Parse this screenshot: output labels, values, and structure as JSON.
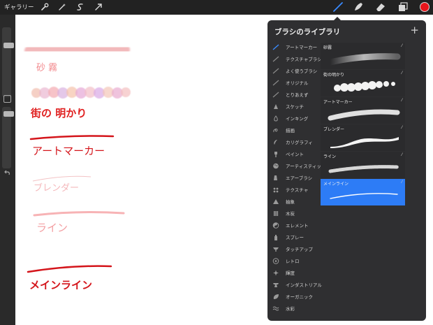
{
  "topbar": {
    "gallery_label": "ギャラリー",
    "tools_left": [
      "wrench-icon",
      "magic-wand-icon",
      "selection-icon",
      "transform-arrow-icon"
    ],
    "tools_right": [
      "brush-icon",
      "smudge-icon",
      "eraser-icon",
      "layers-icon"
    ],
    "active_tool": "brush",
    "current_color": "#e8151b"
  },
  "canvas": {
    "labels": {
      "sunago": "砂 霧",
      "machi": "街の 明かり",
      "art": "アートマーカー",
      "blender": "ブレンダー",
      "line": "ライン",
      "main": "メインライン"
    }
  },
  "panel": {
    "title": "ブラシのライブラリ",
    "add_label": "+",
    "categories": [
      {
        "label": "アートマーカー",
        "icon": "marker-icon"
      },
      {
        "label": "テクスチャブラシ",
        "icon": "stroke-icon"
      },
      {
        "label": "よく使うブラシ",
        "icon": "stroke-icon"
      },
      {
        "label": "オリジナル",
        "icon": "stroke-icon"
      },
      {
        "label": "とりあえず",
        "icon": "stroke-icon"
      },
      {
        "label": "スケッチ",
        "icon": "pencil-icon"
      },
      {
        "label": "インキング",
        "icon": "ink-drop-icon"
      },
      {
        "label": "描画",
        "icon": "loop-icon"
      },
      {
        "label": "カリグラフィ",
        "icon": "calligraphy-icon"
      },
      {
        "label": "ペイント",
        "icon": "paint-brush-icon"
      },
      {
        "label": "アーティスティック",
        "icon": "palette-icon"
      },
      {
        "label": "エアーブラシ",
        "icon": "airbrush-icon"
      },
      {
        "label": "テクスチャ",
        "icon": "texture-icon"
      },
      {
        "label": "抽象",
        "icon": "triangle-icon"
      },
      {
        "label": "木炭",
        "icon": "charcoal-icon"
      },
      {
        "label": "エレメント",
        "icon": "yin-yang-icon"
      },
      {
        "label": "スプレー",
        "icon": "spray-icon"
      },
      {
        "label": "タッチアップ",
        "icon": "touchup-icon"
      },
      {
        "label": "レトロ",
        "icon": "retro-icon"
      },
      {
        "label": "輝度",
        "icon": "sparkle-icon"
      },
      {
        "label": "インダストリアル",
        "icon": "anvil-icon"
      },
      {
        "label": "オーガニック",
        "icon": "leaf-icon"
      },
      {
        "label": "水彩",
        "icon": "water-icon"
      }
    ],
    "selected_category": "アートマーカー",
    "brushes": [
      {
        "name": "砂霧",
        "marker": "⁄"
      },
      {
        "name": "街の明かり",
        "marker": "⁄"
      },
      {
        "name": "アートマーカー",
        "marker": "⁄"
      },
      {
        "name": "ブレンダー",
        "marker": "⁄"
      },
      {
        "name": "ライン",
        "marker": "⁄"
      },
      {
        "name": "メインライン",
        "marker": "⁄"
      }
    ],
    "selected_brush": "メインライン"
  }
}
